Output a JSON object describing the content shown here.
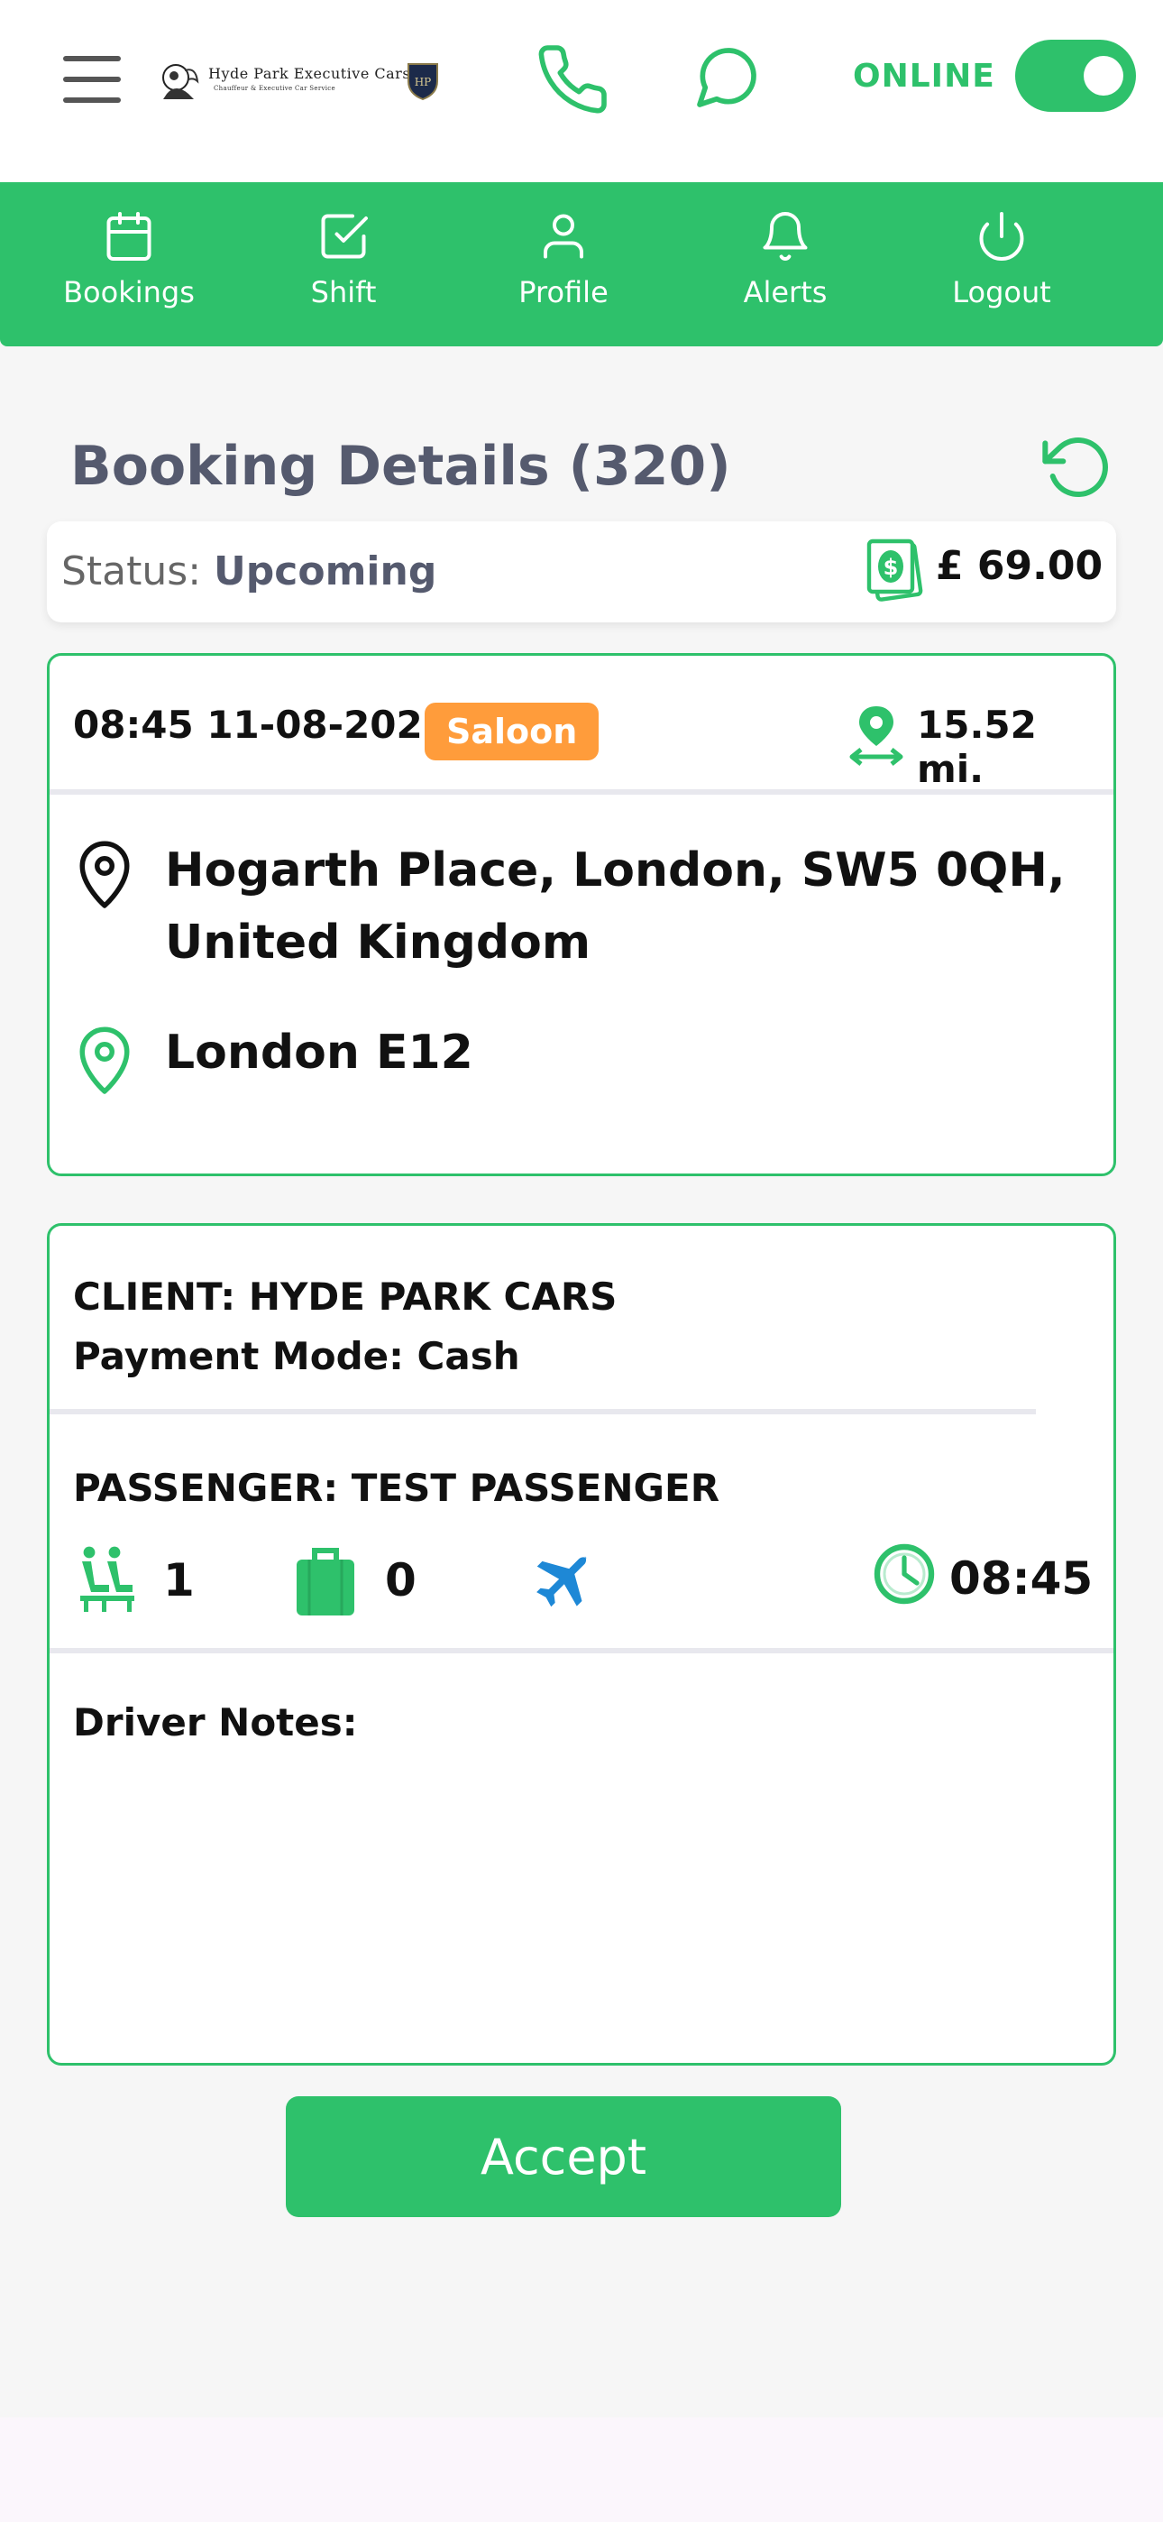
{
  "header": {
    "logo_title": "Hyde Park Executive Cars",
    "logo_subtitle": "Chauffeur & Executive Car Service",
    "online_label": "ONLINE",
    "online": true
  },
  "nav": {
    "items": [
      {
        "label": "Bookings",
        "icon": "calendar-icon"
      },
      {
        "label": "Shift",
        "icon": "checkbox-icon"
      },
      {
        "label": "Profile",
        "icon": "user-icon"
      },
      {
        "label": "Alerts",
        "icon": "bell-icon"
      },
      {
        "label": "Logout",
        "icon": "power-icon"
      }
    ]
  },
  "booking": {
    "title": "Booking Details (320)",
    "status_label": "Status:",
    "status_value": "Upcoming",
    "price": "£ 69.00",
    "datetime": "08:45 11-08-2026",
    "vehicle": "Saloon",
    "distance": "15.52 mi.",
    "pickup": "Hogarth Place, London, SW5 0QH, United Kingdom",
    "dropoff": "London E12",
    "client": "CLIENT: HYDE PARK CARS",
    "payment": "Payment Mode: Cash",
    "passenger": "PASSENGER: TEST PASSENGER",
    "passengers_count": "1",
    "luggage_count": "0",
    "pickup_time": "08:45",
    "notes_label": "Driver Notes:",
    "notes": ""
  },
  "actions": {
    "accept_label": "Accept"
  },
  "colors": {
    "primary": "#2ec16b",
    "badge": "#ff9c3b",
    "title": "#555a6e",
    "flight": "#1e88d6"
  }
}
